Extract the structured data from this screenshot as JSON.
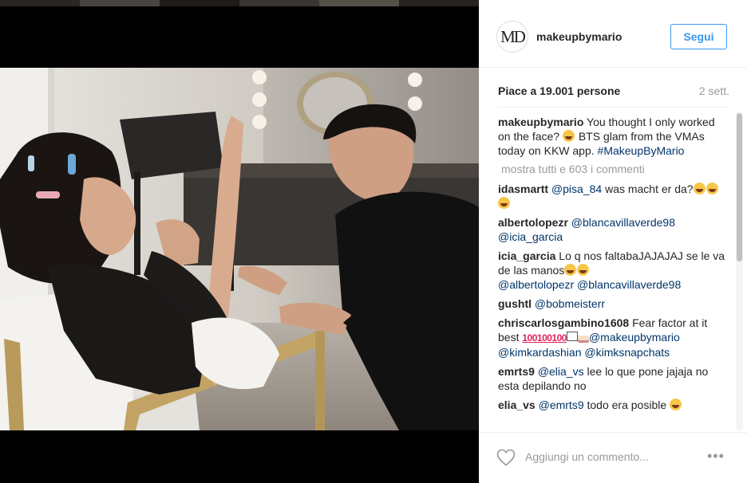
{
  "post": {
    "username": "makeupbymario",
    "avatar_initials": "MD",
    "follow_label": "Segui",
    "likes": "Piace a 19.001 persone",
    "time": "2 sett.",
    "photo_alt": "Makeup artist working on client in backstage room"
  },
  "caption": {
    "user": "makeupbymario",
    "text_before": " You thought I only worked on the face? ",
    "text_after": " BTS glam from the VMAs today on KKW app. ",
    "hashtag": "#MakeupByMario"
  },
  "show_all_label": "mostra tutti e 603 i commenti",
  "comments": [
    {
      "user": "idasmartt",
      "mention": "@pisa_84",
      "text": " was macht er da?"
    },
    {
      "user": "albertolopezr",
      "mention": "@blancavillaverde98",
      "mention2": "@icia_garcia"
    },
    {
      "user": "icia_garcia",
      "text": " Lo q nos faltabaJAJAJAJ se le va de las manos",
      "mention": "@albertolopezr",
      "mention2": "@blancavillaverde98"
    },
    {
      "user": "gushtl",
      "mention": "@bobmeisterr"
    },
    {
      "user": "chriscarlosgambino1608",
      "text": " Fear factor at it best ",
      "hundred": "100",
      "mention": "@makeupbymario",
      "mention2": "@kimkardashian",
      "mention3": "@kimksnapchats"
    },
    {
      "user": "emrts9",
      "mention": "@elia_vs",
      "text": " lee lo que pone jajaja no esta depilando no"
    },
    {
      "user": "elia_vs",
      "mention": "@emrts9",
      "text": " todo era posible"
    }
  ],
  "footer": {
    "add_comment_placeholder": "Aggiungi un commento...",
    "more_label": "•••"
  },
  "colors": {
    "accent": "#3897f0",
    "link": "#003569",
    "muted": "#999999"
  }
}
